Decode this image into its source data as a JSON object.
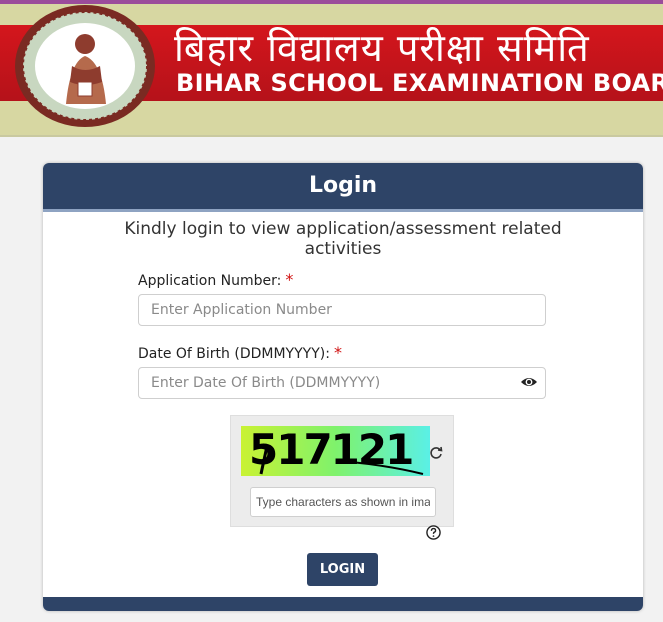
{
  "header": {
    "title_hindi": "बिहार विद्यालय परीक्षा समिति",
    "title_english": "BIHAR SCHOOL EXAMINATION BOARD"
  },
  "login": {
    "heading": "Login",
    "subtitle": "Kindly login to view application/assessment related activities",
    "application_number": {
      "label": "Application Number:",
      "required_mark": "*",
      "placeholder": "Enter Application Number",
      "value": ""
    },
    "dob": {
      "label": "Date Of Birth (DDMMYYYY):",
      "required_mark": "*",
      "placeholder": "Enter Date Of Birth (DDMMYYYY)",
      "value": ""
    },
    "captcha": {
      "image_text": "517121",
      "placeholder": "Type characters as shown in image",
      "value": ""
    },
    "button_label": "LOGIN"
  },
  "colors": {
    "header_red": "#c8141b",
    "card_navy": "#2e4467",
    "required_red": "#d01010"
  },
  "icons": {
    "emblem": "bseb-emblem",
    "eye": "eye-icon",
    "refresh": "refresh-icon",
    "help": "question-circle-icon"
  }
}
